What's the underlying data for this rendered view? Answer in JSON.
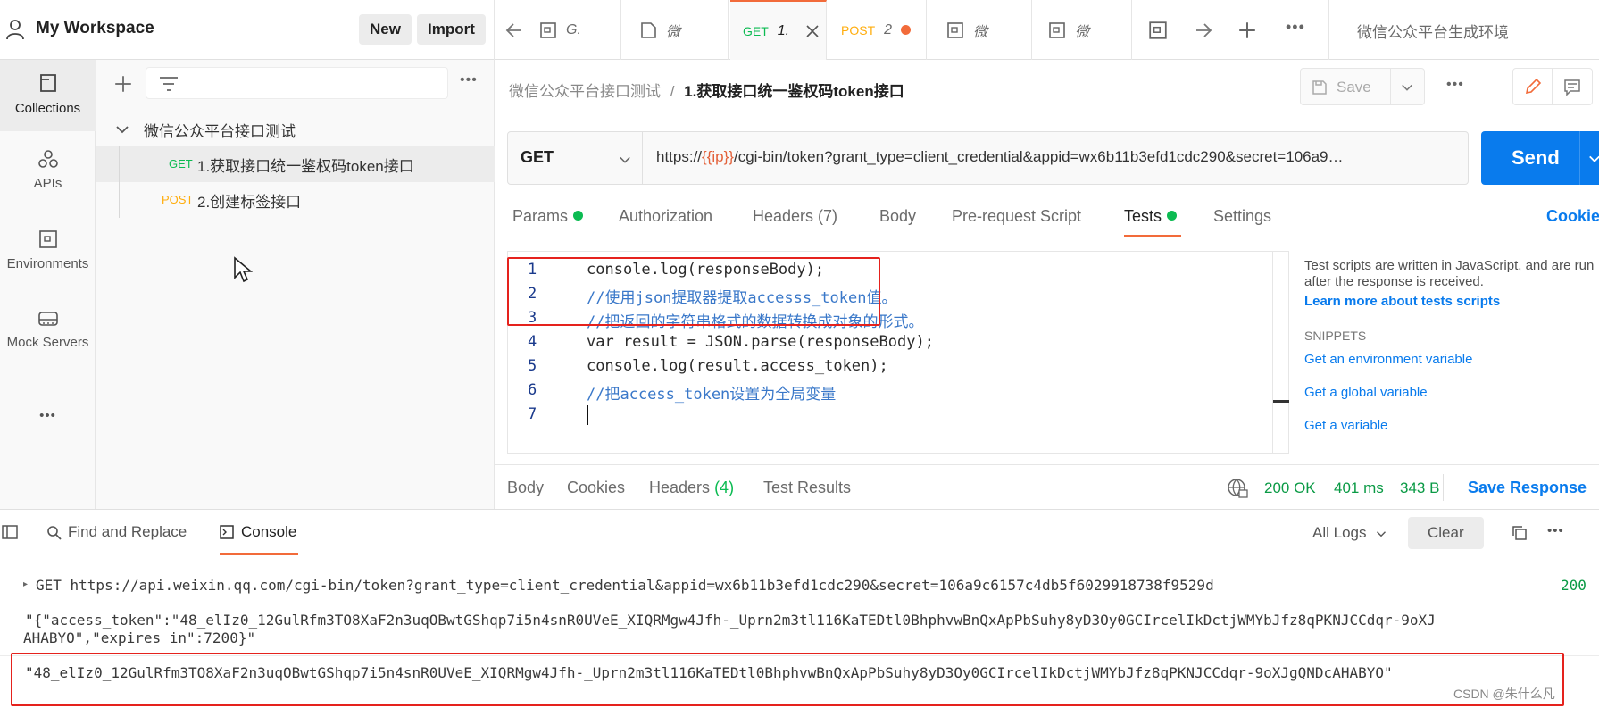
{
  "workspace": {
    "name": "My Workspace",
    "new_label": "New",
    "import_label": "Import"
  },
  "tabs": [
    {
      "label": "G.",
      "kind": "file"
    },
    {
      "label": "微",
      "kind": "doc"
    },
    {
      "method": "GET",
      "label": "1.",
      "active": true
    },
    {
      "method": "POST",
      "label": "2",
      "unsaved": true
    },
    {
      "label": "微",
      "kind": "file"
    },
    {
      "label": "微",
      "kind": "file"
    }
  ],
  "environment": "微信公众平台生成环境",
  "rail": [
    {
      "label": "Collections",
      "icon": "collections-icon",
      "active": true
    },
    {
      "label": "APIs",
      "icon": "apis-icon"
    },
    {
      "label": "Environments",
      "icon": "environments-icon"
    },
    {
      "label": "Mock Servers",
      "icon": "mock-servers-icon"
    },
    {
      "label": "•••",
      "icon": "more-icon"
    }
  ],
  "collection": {
    "name": "微信公众平台接口测试",
    "requests": [
      {
        "method": "GET",
        "name": "1.获取接口统一鉴权码token接口",
        "selected": true
      },
      {
        "method": "POST",
        "name": "2.创建标签接口"
      }
    ]
  },
  "breadcrumb": {
    "parent": "微信公众平台接口测试",
    "sep": "/",
    "current": "1.获取接口统一鉴权码token接口"
  },
  "save_label": "Save",
  "request": {
    "method": "GET",
    "url_prefix": "https://",
    "url_var": "{{ip}}",
    "url_rest": "/cgi-bin/token?grant_type=client_credential&appid=wx6b11b3efd1cdc290&secret=106a9…",
    "send_label": "Send"
  },
  "request_tabs": [
    {
      "label": "Params",
      "dot": true
    },
    {
      "label": "Authorization"
    },
    {
      "label": "Headers (7)"
    },
    {
      "label": "Body"
    },
    {
      "label": "Pre-request Script"
    },
    {
      "label": "Tests",
      "dot": true,
      "active": true
    },
    {
      "label": "Settings"
    }
  ],
  "cookies_label": "Cookie",
  "editor_lines": [
    {
      "n": "1",
      "text": "console.log(responseBody);"
    },
    {
      "n": "2",
      "text": "//使用json提取器提取accesss_token值。"
    },
    {
      "n": "3",
      "text": "//把返回的字符串格式的数据转换成对象的形式。"
    },
    {
      "n": "4",
      "text": "var result = JSON.parse(responseBody);"
    },
    {
      "n": "5",
      "text": "console.log(result.access_token);"
    },
    {
      "n": "6",
      "text": "//把access_token设置为全局变量"
    },
    {
      "n": "7",
      "text": ""
    }
  ],
  "snippets": {
    "intro": "Test scripts are written in JavaScript, and are run after the response is received.",
    "learn_more": "Learn more about tests scripts",
    "heading": "SNIPPETS",
    "items": [
      "Get an environment variable",
      "Get a global variable",
      "Get a variable"
    ]
  },
  "response_tabs": [
    {
      "label": "Body"
    },
    {
      "label": "Cookies"
    },
    {
      "label": "Headers",
      "count": "(4)"
    },
    {
      "label": "Test Results"
    }
  ],
  "response_status": {
    "code": "200 OK",
    "time": "401 ms",
    "size": "343 B",
    "save_label": "Save Response"
  },
  "console": {
    "tabs": [
      {
        "label": "Find and Replace"
      },
      {
        "label": "Console",
        "active": true
      }
    ],
    "log_filter": "All Logs",
    "clear_label": "Clear",
    "lines": {
      "request": "GET https://api.weixin.qq.com/cgi-bin/token?grant_type=client_credential&appid=wx6b11b3efd1cdc290&secret=106a9c6157c4db5f6029918738f9529d",
      "request_status": "200",
      "body_1": "\"{\"access_token\":\"48_elIz0_12GulRfm3TO8XaF2n3uqOBwtGShqp7i5n4snR0UVeE_XIQRMgw4Jfh-_Uprn2m3tl116KaTEDtl0BhphvwBnQxApPbSuhy8yD3Oy0GCIrcelIkDctjWMYbJfz8qPKNJCCdqr-9oXJ",
      "body_2": "AHABYO\",\"expires_in\":7200}\"",
      "token": "\"48_elIz0_12GulRfm3TO8XaF2n3uqOBwtGShqp7i5n4snR0UVeE_XIQRMgw4Jfh-_Uprn2m3tl116KaTEDtl0BhphvwBnQxApPbSuhy8yD3Oy0GCIrcelIkDctjWMYbJfz8qPKNJCCdqr-9oXJgQNDcAHABYO\""
    }
  },
  "watermark": "CSDN @朱什么凡",
  "colors": {
    "accent": "#f26b3a",
    "send": "#097bed",
    "get": "#0cbb52",
    "post": "#ffad0d",
    "annotation": "#e5221d"
  }
}
